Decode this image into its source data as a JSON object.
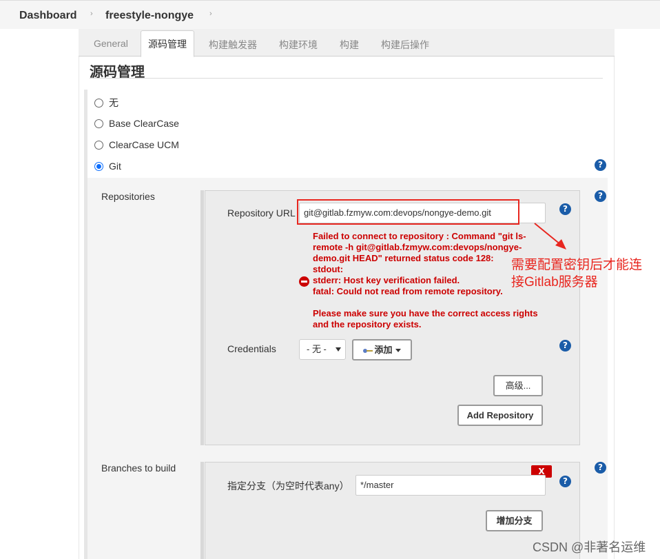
{
  "breadcrumb": {
    "dashboard": "Dashboard",
    "job": "freestyle-nongye",
    "separator": "›"
  },
  "tabs": [
    {
      "label": "General",
      "active": false
    },
    {
      "label": "源码管理",
      "active": true
    },
    {
      "label": "构建触发器",
      "active": false
    },
    {
      "label": "构建环境",
      "active": false
    },
    {
      "label": "构建",
      "active": false
    },
    {
      "label": "构建后操作",
      "active": false
    }
  ],
  "section": {
    "title": "源码管理"
  },
  "scm_options": [
    {
      "label": "无",
      "checked": false
    },
    {
      "label": "Base ClearCase",
      "checked": false
    },
    {
      "label": "ClearCase UCM",
      "checked": false
    },
    {
      "label": "Git",
      "checked": true
    }
  ],
  "repositories": {
    "label": "Repositories",
    "url_label": "Repository URL",
    "url_value": "git@gitlab.fzmyw.com:devops/nongye-demo.git",
    "error_lines": [
      "Failed to connect to repository : Command \"git ls-",
      "remote -h git@gitlab.fzmyw.com:devops/nongye-",
      "demo.git HEAD\" returned status code 128:",
      "stdout:",
      "stderr: Host key verification failed.",
      "fatal: Could not read from remote repository."
    ],
    "error_hint_lines": [
      "Please make sure you have the correct access rights",
      "and the repository exists."
    ],
    "credentials_label": "Credentials",
    "credentials_value": "- 无 -",
    "add_button": "添加",
    "advanced_button": "高级...",
    "add_repository_button": "Add Repository"
  },
  "annotation": {
    "line1": "需要配置密钥后才能连",
    "line2": "接Gitlab服务器",
    "color": "#e8261f"
  },
  "branches": {
    "label": "Branches to build",
    "branch_label": "指定分支（为空时代表any）",
    "branch_value": "*/master",
    "delete_button": "X",
    "add_branch_button": "增加分支"
  },
  "help_glyph": "?",
  "watermark": "CSDN @非著名运维"
}
